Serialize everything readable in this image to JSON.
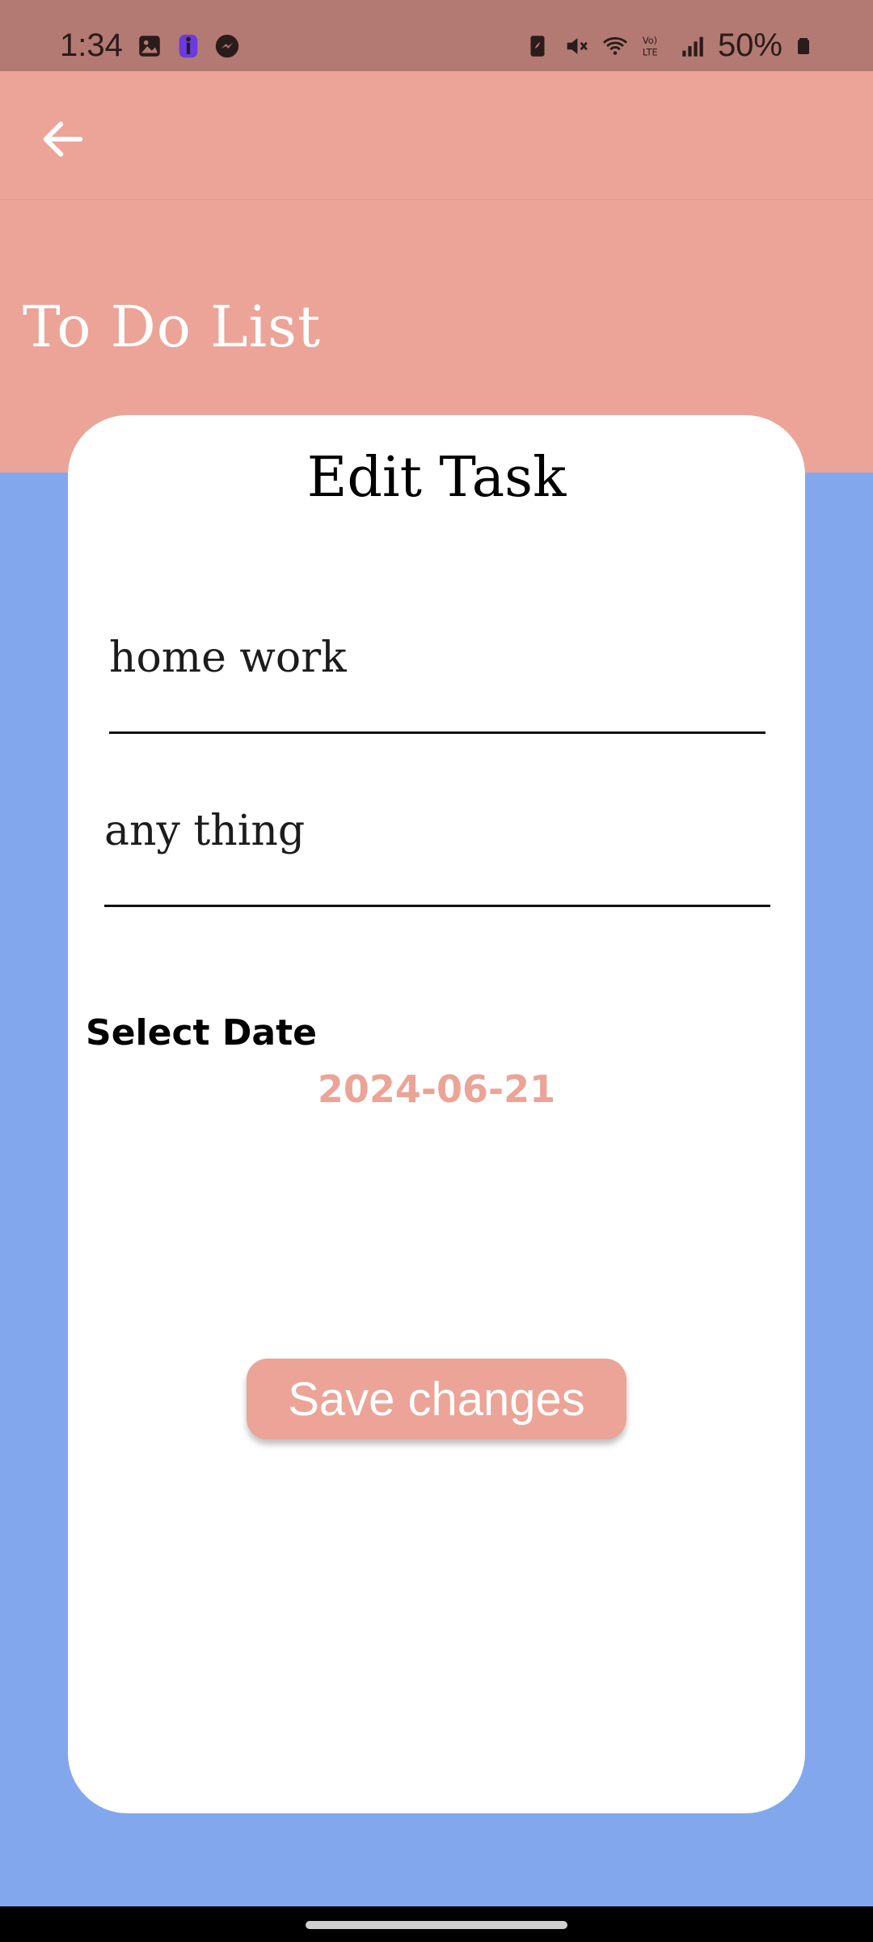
{
  "status_bar": {
    "time": "1:34",
    "battery": "50%",
    "left_icons": [
      "gallery-icon",
      "accessibility-icon",
      "messenger-icon"
    ],
    "right_icons": [
      "battery-saver-icon",
      "mute-icon",
      "wifi-icon",
      "volte-icon",
      "signal-icon",
      "battery-icon"
    ]
  },
  "app_bar": {
    "back_icon": "arrow-left-icon",
    "title": "To Do List"
  },
  "card": {
    "title": "Edit Task",
    "task_title_value": "home work",
    "task_description_value": "any thing",
    "select_date_label": "Select Date",
    "date_value": "2024-06-21",
    "save_label": "Save changes"
  },
  "colors": {
    "accent": "#eba497",
    "background": "#82a7ec",
    "status_bar": "#b27a72",
    "card": "#ffffff"
  }
}
